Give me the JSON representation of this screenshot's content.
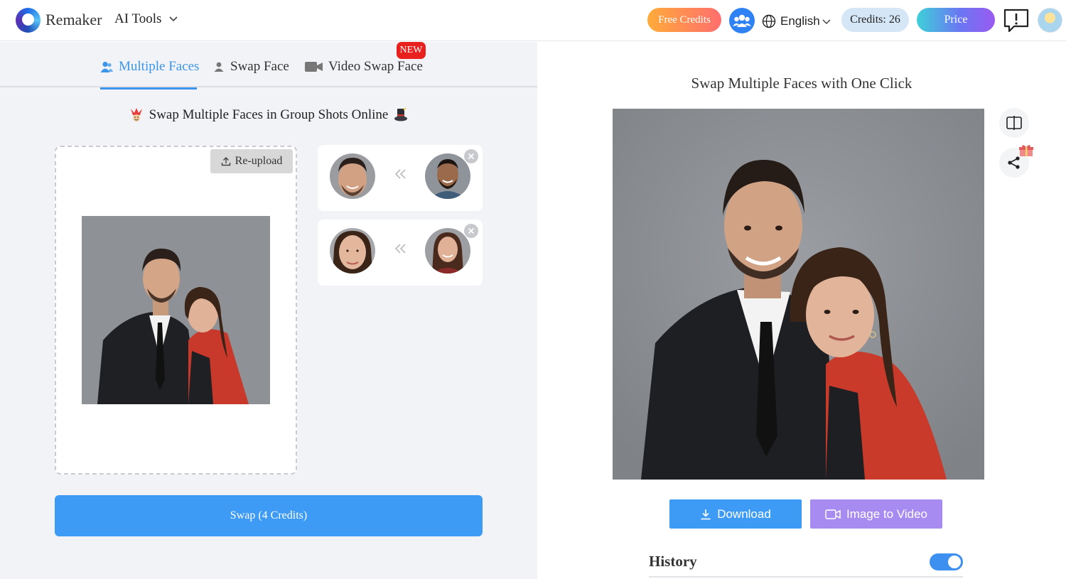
{
  "header": {
    "brand": "Remaker",
    "ai_tools_label": "AI Tools",
    "free_credits_label": "Free Credits",
    "language": "English",
    "credits_label": "Credits: 26",
    "price_label": "Price"
  },
  "tabs": [
    {
      "label": "Multiple Faces",
      "active": true
    },
    {
      "label": "Swap Face",
      "active": false
    },
    {
      "label": "Video Swap Face",
      "active": false,
      "badge": "NEW"
    }
  ],
  "left": {
    "subtitle": "Swap Multiple Faces in Group Shots Online",
    "reupload_label": "Re-upload",
    "face_pairs_count": 2,
    "swap_button_label": "Swap (4 Credits)"
  },
  "right": {
    "title": "Swap Multiple Faces with One Click",
    "download_label": "Download",
    "image_to_video_label": "Image to Video",
    "history_label": "History",
    "history_toggle_on": true
  },
  "colors": {
    "accent_blue": "#3d9bf6",
    "tab_active": "#3b95ea",
    "new_badge": "#e8201e",
    "image_to_video": "#a78bf0",
    "credits_pill": "#d5e6f6"
  },
  "icons": [
    "remaker-logo-icon",
    "chevron-down-icon",
    "community-icon",
    "globe-icon",
    "feedback-icon",
    "user-avatar-icon",
    "users-icon",
    "user-icon",
    "video-camera-icon",
    "upload-icon",
    "double-chevron-left-icon",
    "close-icon",
    "compare-icon",
    "share-icon",
    "gift-icon",
    "download-icon",
    "video-icon"
  ]
}
